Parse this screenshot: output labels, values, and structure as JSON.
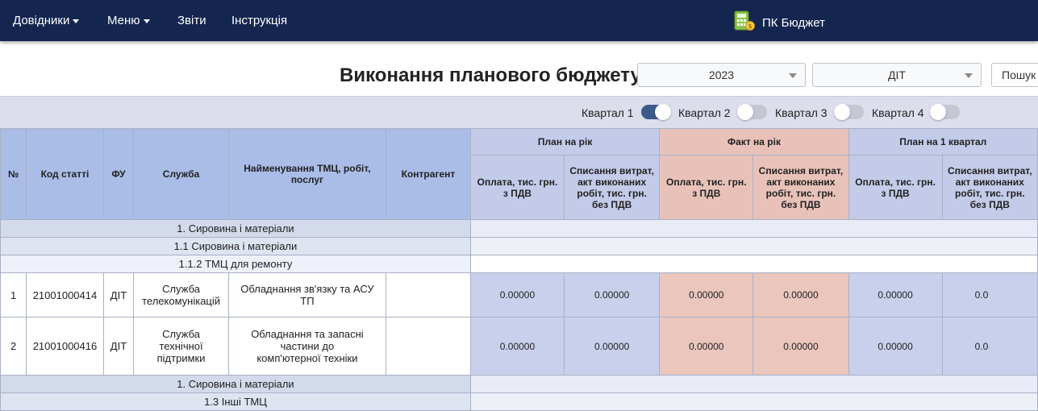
{
  "nav": {
    "items": [
      {
        "label": "Довідники",
        "has_caret": true
      },
      {
        "label": "Меню",
        "has_caret": true
      },
      {
        "label": "Звіти",
        "has_caret": false
      },
      {
        "label": "Інструкція",
        "has_caret": false
      }
    ],
    "brand": {
      "title": "ПК Бюджет",
      "icon": "calculator-money-icon"
    },
    "colors": {
      "background": "#142650"
    }
  },
  "page": {
    "title": "Виконання планового бюджету",
    "year_select": "2023",
    "department_select": "ДІТ",
    "search_button": "Пошук"
  },
  "quarters": [
    {
      "label": "Квартал 1",
      "on": true
    },
    {
      "label": "Квартал 2",
      "on": false
    },
    {
      "label": "Квартал 3",
      "on": false
    },
    {
      "label": "Квартал 4",
      "on": false
    }
  ],
  "table": {
    "headers": {
      "num": "№",
      "code": "Код статті",
      "fu": "ФУ",
      "service": "Служба",
      "name": "Найменування ТМЦ, робіт, послуг",
      "contractor": "Контрагент",
      "plan_year": "План на рік",
      "fact_year": "Факт на рік",
      "plan_q1": "План на 1 квартал",
      "payment": "Оплата, тис. грн. з ПДВ",
      "writeoff": "Списання витрат, акт виконаних робіт, тис. грн. без ПДВ"
    },
    "groups": {
      "g1": "1. Сировина і матеріали",
      "g1_1": "1.1 Сировина і матеріали",
      "g1_1_2": "1.1.2 ТМЦ для ремонту",
      "g1_again": "1. Сировина і матеріали",
      "g1_3": "1.3 Інші ТМЦ"
    },
    "rows": [
      {
        "num": "1",
        "code": "21001000414",
        "fu": "ДІТ",
        "service": "Служба телекомунікацій",
        "name": "Обладнання зв'язку та АСУ ТП",
        "contractor": "",
        "values": [
          "0.00000",
          "0.00000",
          "0.00000",
          "0.00000",
          "0.00000",
          "0.0"
        ]
      },
      {
        "num": "2",
        "code": "21001000416",
        "fu": "ДІТ",
        "service": "Служба технічної підтримки",
        "name": "Обладнання та запасні частини до комп'ютерної техніки",
        "contractor": "",
        "values": [
          "0.00000",
          "0.00000",
          "0.00000",
          "0.00000",
          "0.00000",
          "0.0"
        ]
      }
    ],
    "colors": {
      "left_header": "#a9bde7",
      "plan": "#c3cbe9",
      "fact": "#e8c2b9"
    }
  }
}
